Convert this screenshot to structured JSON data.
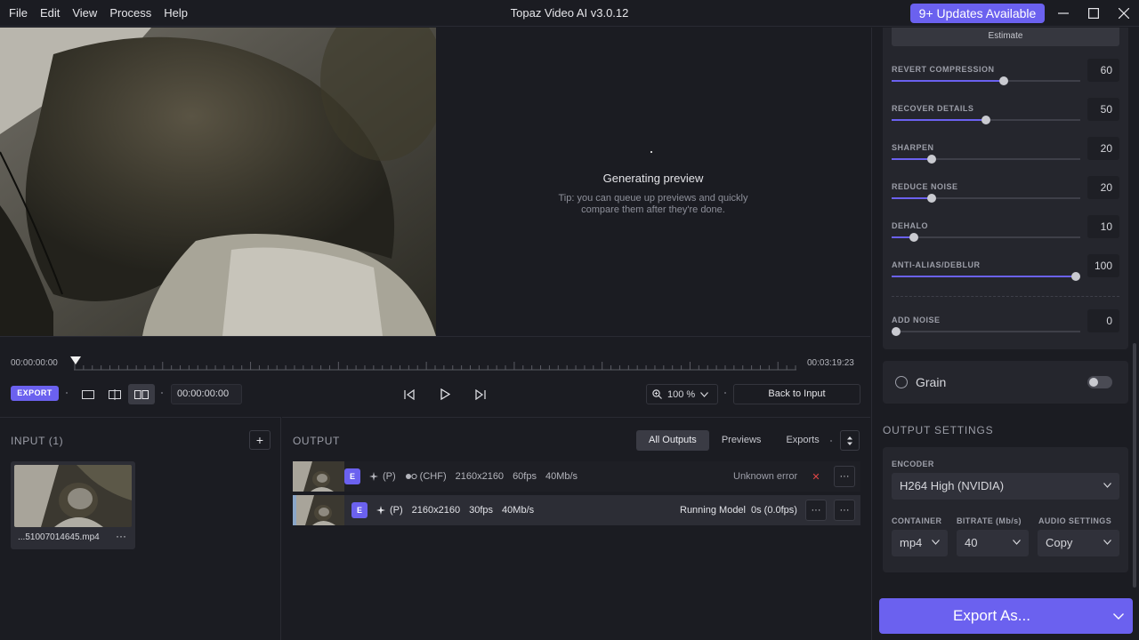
{
  "menu": [
    "File",
    "Edit",
    "View",
    "Process",
    "Help"
  ],
  "app_title": "Topaz Video AI  v3.0.12",
  "updates_button": "9+ Updates Available",
  "preview": {
    "status_title": "Generating preview",
    "tip": "Tip: you can queue up previews and quickly compare them after they're done."
  },
  "timeline": {
    "start_time": "00:00:00:00",
    "end_time": "00:03:19:23",
    "export_pill": "EXPORT",
    "timecode": "00:00:00:00",
    "zoom": "100 %",
    "back_to_input": "Back to Input"
  },
  "input_panel": {
    "heading": "INPUT (1)",
    "add_label": "+",
    "clip_name": "...51007014645.mp4",
    "clip_more": "···"
  },
  "output_panel": {
    "heading": "OUTPUT",
    "tabs": [
      "All Outputs",
      "Previews",
      "Exports"
    ],
    "rows": [
      {
        "badge": "E",
        "mode": "(P)",
        "extra": "(CHF)",
        "resolution": "2160x2160",
        "fps": "60fps",
        "bitrate": "40Mb/s",
        "status": "Unknown error",
        "status_time": ""
      },
      {
        "badge": "E",
        "mode": "(P)",
        "extra": "",
        "resolution": "2160x2160",
        "fps": "30fps",
        "bitrate": "40Mb/s",
        "status": "Running Model",
        "status_time": "0s (0.0fps)"
      }
    ],
    "more_label": "···",
    "close_label": "✕"
  },
  "enhancement": {
    "estimate": "Estimate",
    "sliders": [
      {
        "label": "REVERT COMPRESSION",
        "value": "60",
        "level": 0.6
      },
      {
        "label": "RECOVER DETAILS",
        "value": "50",
        "level": 0.5
      },
      {
        "label": "SHARPEN",
        "value": "20",
        "level": 0.2
      },
      {
        "label": "REDUCE NOISE",
        "value": "20",
        "level": 0.2
      },
      {
        "label": "DEHALO",
        "value": "10",
        "level": 0.1
      },
      {
        "label": "ANTI-ALIAS/DEBLUR",
        "value": "100",
        "level": 1.0
      },
      {
        "label": "ADD NOISE",
        "value": "0",
        "level": 0.0
      }
    ]
  },
  "grain": {
    "label": "Grain",
    "enabled": false
  },
  "output_settings": {
    "heading": "OUTPUT SETTINGS",
    "encoder_label": "ENCODER",
    "encoder_value": "H264 High (NVIDIA)",
    "container_label": "CONTAINER",
    "container_value": "mp4",
    "bitrate_label": "BITRATE (Mb/s)",
    "bitrate_value": "40",
    "audio_label": "AUDIO SETTINGS",
    "audio_value": "Copy"
  },
  "export_as": "Export As...",
  "colors": {
    "accent": "#6b61ef",
    "background": "#1b1c22",
    "card": "#25262d",
    "error": "#e04646"
  }
}
